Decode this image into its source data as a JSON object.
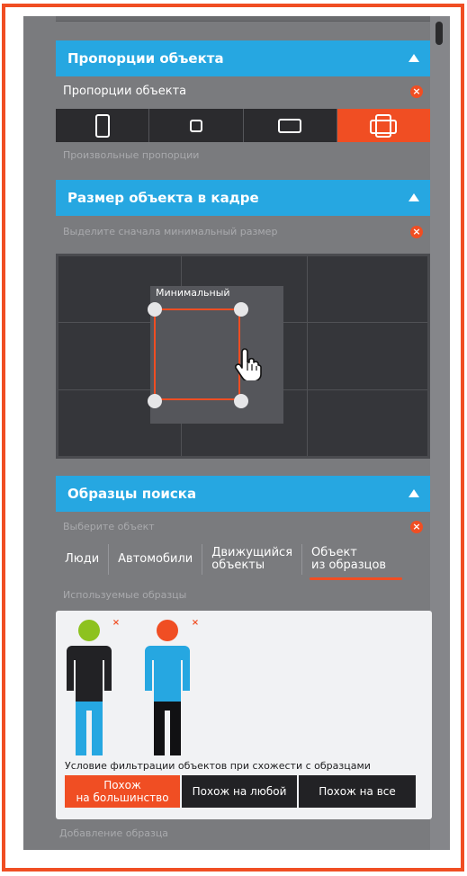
{
  "proportions": {
    "header_title": "Пропорции объекта",
    "row_label": "Пропорции объекта",
    "hint": "Произвольные пропорции",
    "options": [
      {
        "icon": "portrait-icon",
        "active": false
      },
      {
        "icon": "square-icon",
        "active": false
      },
      {
        "icon": "landscape-icon",
        "active": false
      },
      {
        "icon": "free-proportion-icon",
        "active": true
      }
    ]
  },
  "object_size": {
    "header_title": "Размер объекта в кадре",
    "hint": "Выделите сначала минимальный размер",
    "min_label": "Минимальный"
  },
  "search_samples": {
    "header_title": "Образцы поиска",
    "hint": "Выберите объект",
    "tabs": [
      "Люди",
      "Автомобили",
      "Движущийся объекты",
      "Объект из образцов"
    ],
    "tab_lines": [
      [
        "Люди"
      ],
      [
        "Автомобили"
      ],
      [
        "Движущийся",
        "объекты"
      ],
      [
        "Объект",
        "из образцов"
      ]
    ],
    "active_tab": 3,
    "used_samples_label": "Используемые образцы",
    "samples": [
      {
        "head_color": "#8dc21f",
        "torso_color": "#222225",
        "legs_color": "#26a7e1"
      },
      {
        "head_color": "#f04e23",
        "torso_color": "#26a7e1",
        "legs_color": "#111113"
      }
    ],
    "filter_label": "Условие фильтрации объектов при схожести с образцами",
    "filter_options": [
      {
        "line1": "Похож",
        "line2": "на большинство",
        "active": true
      },
      {
        "line1": "Похож на любой",
        "line2": "",
        "active": false
      },
      {
        "line1": "Похож на все",
        "line2": "",
        "active": false
      }
    ],
    "add_sample_label": "Добавление образца"
  },
  "colors": {
    "accent": "#f04e23",
    "header": "#26a7e1",
    "panel": "#7a7b7e"
  }
}
